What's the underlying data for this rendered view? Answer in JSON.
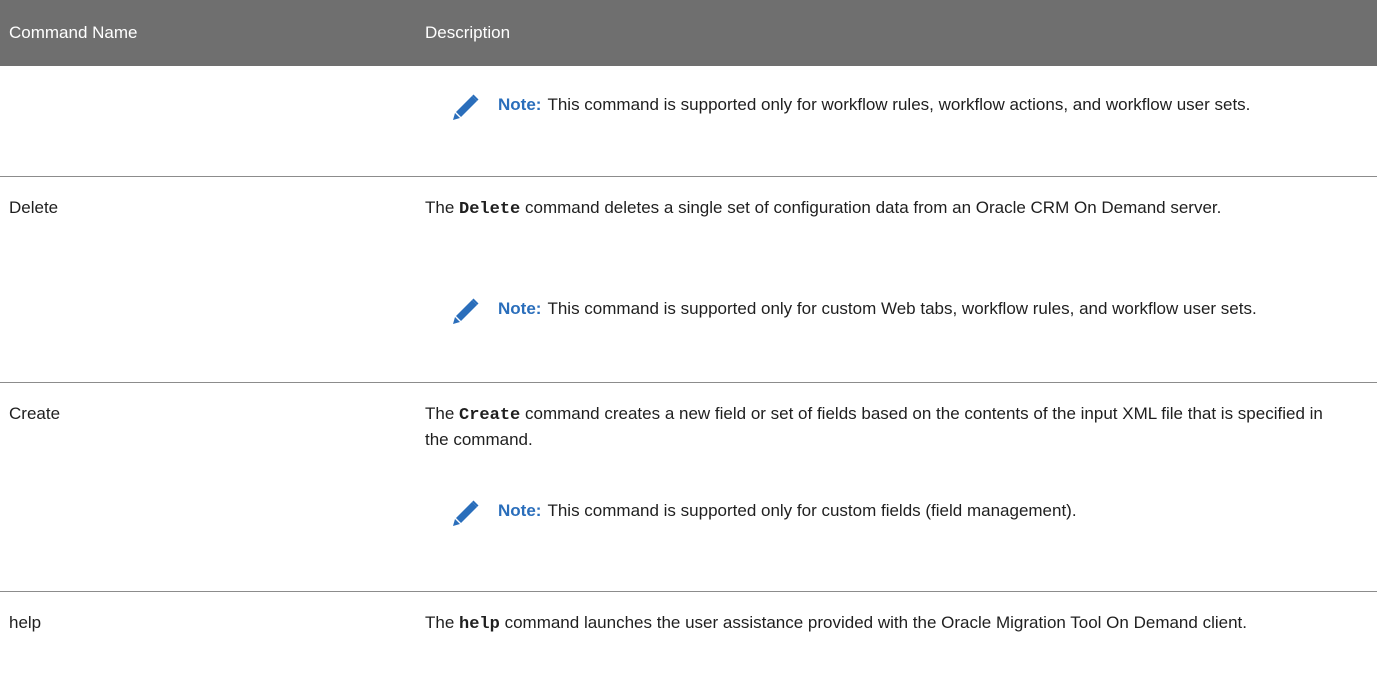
{
  "table": {
    "header": {
      "col_command": "Command Name",
      "col_description": "Description"
    },
    "note_label": "Note:",
    "rows": [
      {
        "command": "",
        "description_prefix": "",
        "code": "",
        "description_suffix": "",
        "note": "This command is supported only for workflow rules, workflow actions, and workflow user sets."
      },
      {
        "command": "Delete",
        "description_prefix": "The",
        "code": "Delete",
        "description_suffix": "command deletes a single set of configuration data from an Oracle CRM On Demand server.",
        "note": "This command is supported only for custom Web tabs, workflow rules, and workflow user sets."
      },
      {
        "command": "Create",
        "description_prefix": "The",
        "code": "Create",
        "description_suffix": "command creates a new field or set of fields based on the contents of the input XML file that is specified in the command.",
        "note": "This command is supported only for custom fields (field management)."
      },
      {
        "command": "help",
        "description_prefix": "The",
        "code": "help",
        "description_suffix": "command launches the user assistance provided with the Oracle Migration Tool On Demand client.",
        "note": ""
      }
    ]
  },
  "colors": {
    "header_bg": "#6f6f6f",
    "header_text": "#ffffff",
    "note_label": "#2a6ebb",
    "pencil_icon": "#2a6ebb",
    "divider": "#8c8c8c"
  },
  "icons": {
    "note_icon": "pencil-icon"
  }
}
